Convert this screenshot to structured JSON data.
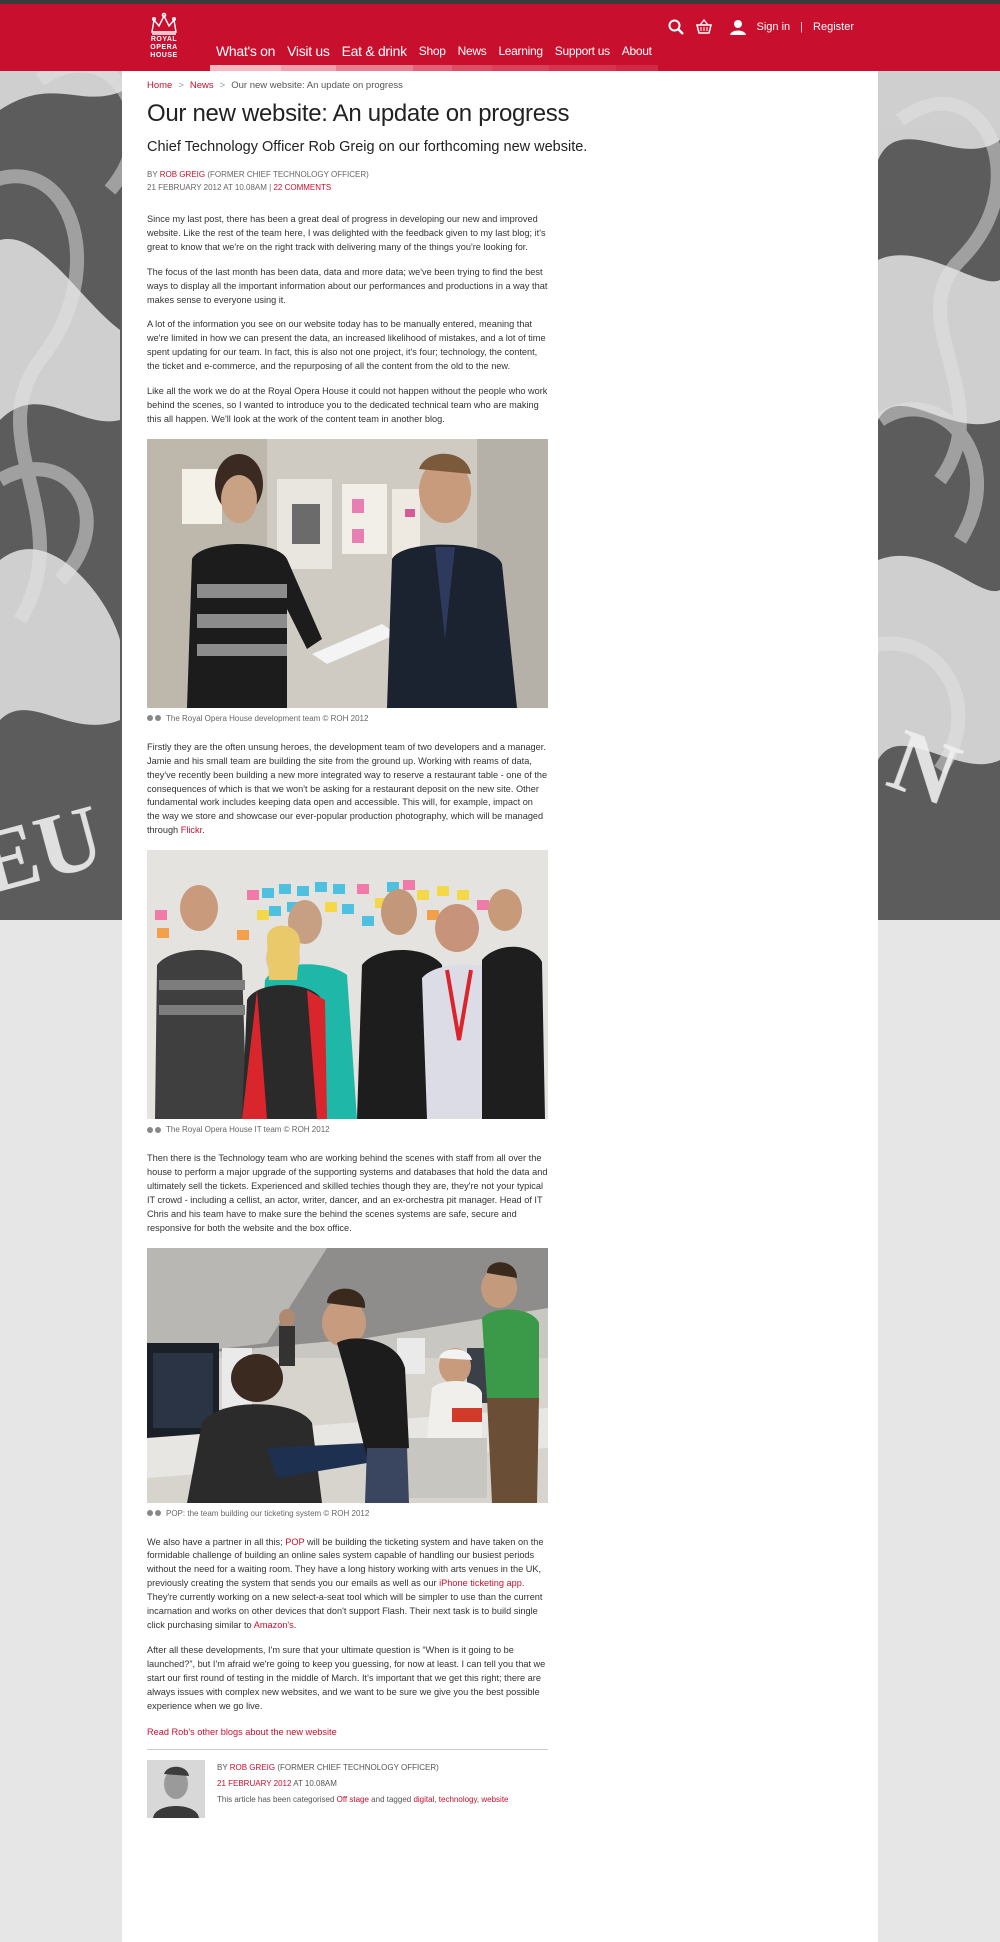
{
  "header": {
    "logo_lines": [
      "ROYAL",
      "OPERA",
      "HOUSE"
    ],
    "nav": [
      "What's on",
      "Visit us",
      "Eat & drink",
      "Shop",
      "News",
      "Learning",
      "Support us",
      "About"
    ],
    "sign_in": "Sign in",
    "separator": "|",
    "register": "Register"
  },
  "breadcrumb": {
    "home": "Home",
    "news": "News",
    "current": "Our new website: An update on progress",
    "chevron": ">"
  },
  "article": {
    "title": "Our new website: An update on progress",
    "subtitle": "Chief Technology Officer Rob Greig on our forthcoming new website.",
    "by_prefix": "BY ",
    "author": "ROB GREIG",
    "author_role": " (FORMER CHIEF TECHNOLOGY OFFICER)",
    "date": "21 FEBRUARY 2012 AT 10.08AM | ",
    "comments": "22 COMMENTS",
    "p1": "Since my last post, there has been a great deal of progress in developing our new and improved website. Like the rest of the team here, I was delighted with the feedback given to my last blog; it's great to know that we're on the right track with delivering many of the things you're looking for.",
    "p2": "The focus of the last month has been data, data and more data; we've been trying to find the best ways to display all the important information about our performances and productions in a way that makes sense to everyone using it.",
    "p3": "A lot of the information you see on our website today has to be manually entered, meaning that we're limited in how we can present the data, an increased likelihood of mistakes, and a lot of time spent updating for our team. In fact, this is also not one project, it's four; technology, the content, the ticket and e-commerce, and the repurposing of all the content from the old to the new.",
    "p4": "Like all the work we do at the Royal Opera House it could not happen without the people who work behind the scenes, so I wanted to introduce you to the dedicated technical team who are making this all happen. We'll look at the work of the content team in another blog.",
    "caption1": "The Royal Opera House development team © ROH 2012",
    "p5_a": "Firstly they are the often unsung heroes, the development team of two developers and a manager. Jamie and his small team are building the site from the ground up. Working with reams of data, they've recently been building a new more integrated way to reserve a restaurant table - one of the consequences of which is that we won't be asking for a restaurant deposit on the new site. Other fundamental work includes keeping data open and accessible. This will, for example,  impact on the way we store and showcase our ever-popular production photography, which will be managed through ",
    "p5_link": "Flickr",
    "p5_end": ".",
    "caption2": "The Royal Opera House IT team © ROH 2012",
    "p6": "Then there is the Technology team who are working behind the scenes with staff from all over the house to perform a major upgrade of the supporting systems and databases that hold the data and ultimately sell the tickets. Experienced and skilled techies though they are, they're not your typical IT crowd - including a cellist, an actor, writer, dancer, and an ex-orchestra pit manager. Head of IT Chris and his team have to make sure the behind the scenes systems are safe, secure and responsive for both the website and the box office.",
    "caption3": "POP: the team building our ticketing system © ROH 2012",
    "p7_a": "We also have a partner in all this; ",
    "p7_link1": "POP",
    "p7_b": " will be building the ticketing system and have taken on the formidable challenge of building an online sales system capable of handling our busiest periods without the need for a waiting room. They have a long history working with arts venues in the UK, previously creating the system that sends you our emails as well as our ",
    "p7_link2": "iPhone ticketing app",
    "p7_c": ". They're currently working on a new select-a-seat tool which will be simpler to use than the current incarnation and works on other devices that don't support Flash. Their next task is to build single click purchasing similar to ",
    "p7_link3": "Amazon's",
    "p7_end": ".",
    "p8": "After all these developments, I'm sure that your ultimate question is “When is it going to be launched?”, but I'm afraid we're going to keep you guessing, for now at least. I can tell you that we start our first round of testing in the middle of March. It's important that we get this right; there are always issues with complex new websites, and we want to be sure we give you the best possible experience when we go live.",
    "read_more": "Read Rob's other blogs about the new website"
  },
  "author_box": {
    "by": "BY ",
    "author": "ROB GREIG",
    "role": " (FORMER CHIEF TECHNOLOGY OFFICER)",
    "date": "21 FEBRUARY 2012",
    "time": " AT 10.08AM",
    "cat_prefix": "This article has been categorised ",
    "category": "Off stage",
    "tag_prefix": " and tagged ",
    "tag1": "digital",
    "comma": ", ",
    "tag2": "technology",
    "tag3": "website"
  },
  "colors": {
    "brand": "#c8102e",
    "page_bg": "#e6e6e6"
  }
}
